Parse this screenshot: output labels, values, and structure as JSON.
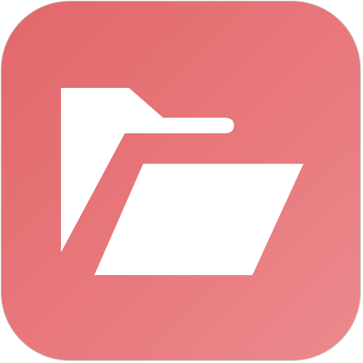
{
  "app_icon": {
    "icon": "open-folder-icon",
    "colors": {
      "tile_gradient_start": "#e2676a",
      "tile_gradient_mid": "#e8797d",
      "tile_gradient_end": "#ec8a8e",
      "glyph": "#ffffff",
      "outline": "#c7c7c7"
    }
  }
}
